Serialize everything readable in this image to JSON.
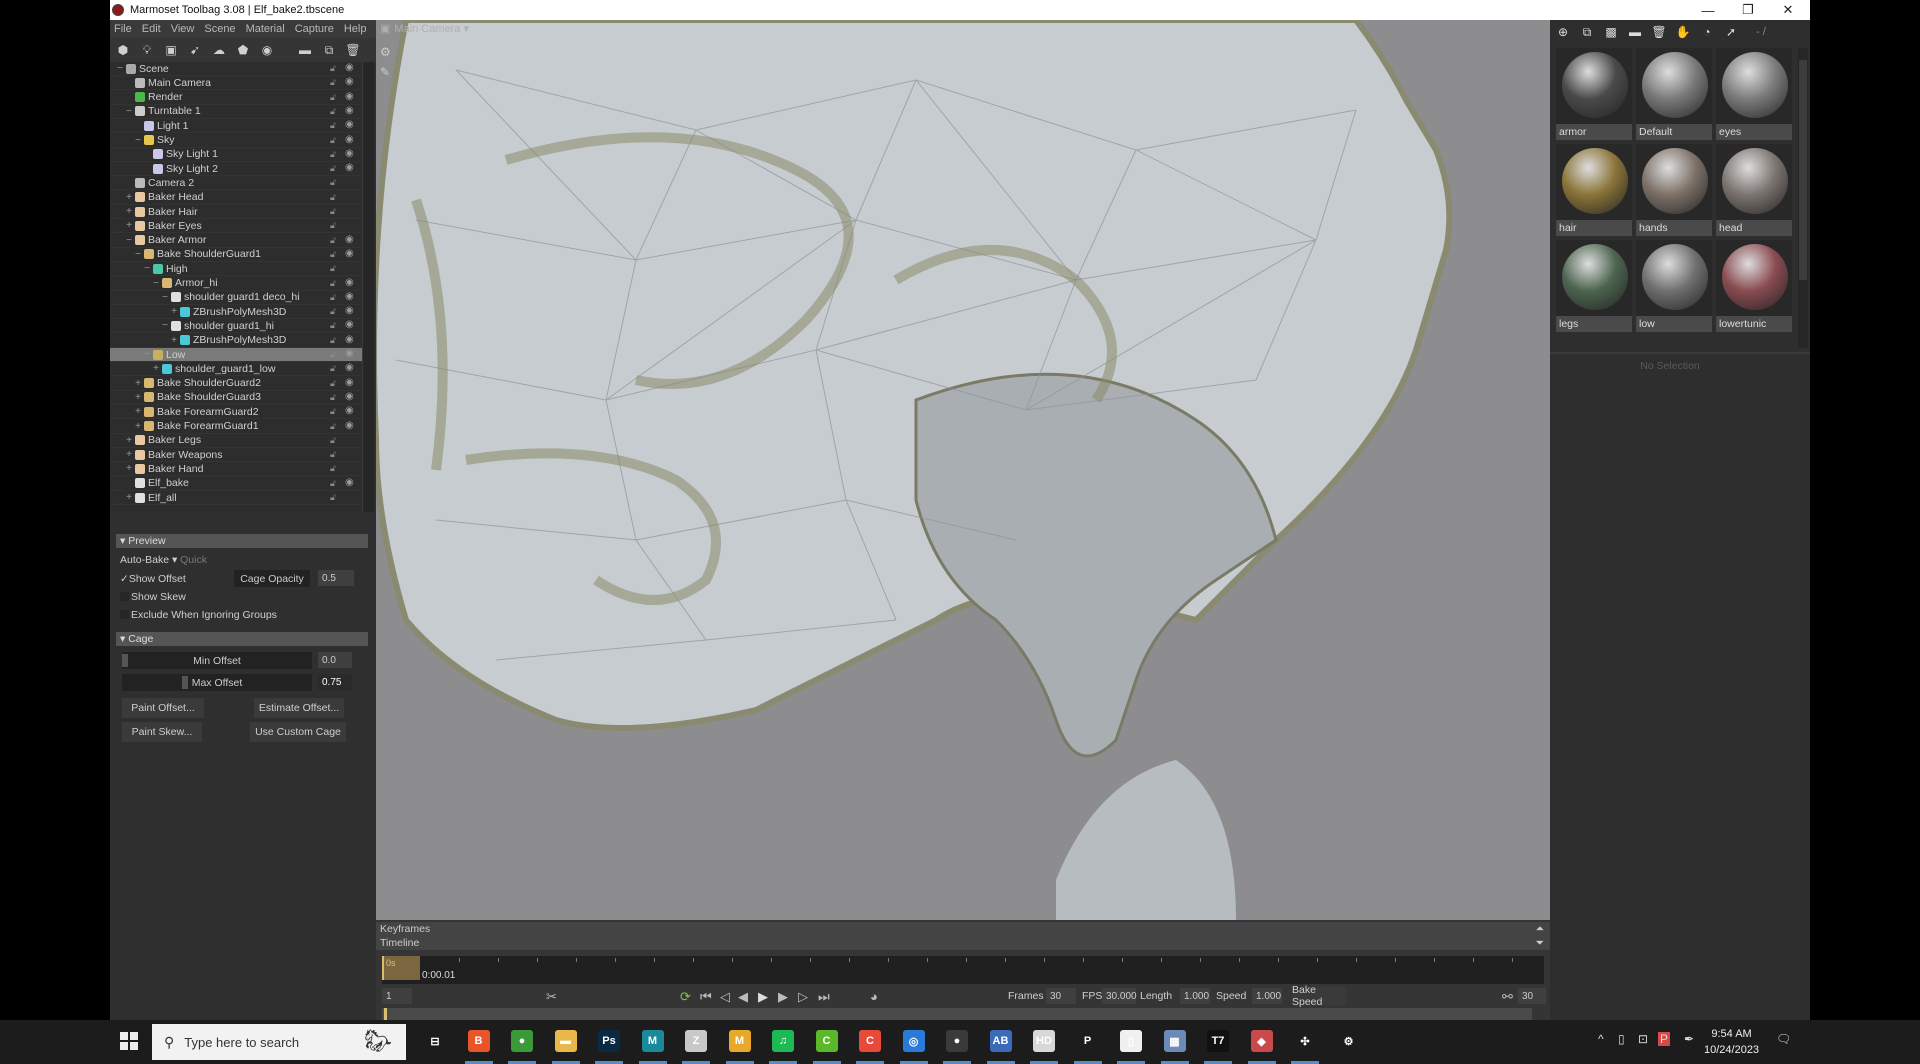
{
  "window": {
    "title": "Marmoset Toolbag 3.08 | Elf_bake2.tbscene",
    "controls": [
      "minimize",
      "restore",
      "close"
    ]
  },
  "menu": [
    "File",
    "Edit",
    "View",
    "Scene",
    "Material",
    "Capture",
    "Help"
  ],
  "toolbar_icons": [
    "new-mesh-icon",
    "new-light-icon",
    "new-camera-icon",
    "new-turntable-icon",
    "new-sky-icon",
    "new-baker-icon",
    "new-render-icon",
    "open-folder-icon",
    "duplicate-icon",
    "delete-icon"
  ],
  "scene_tree": [
    {
      "label": "Scene",
      "depth": 0,
      "icon": "scene",
      "exp": "−",
      "eye": true
    },
    {
      "label": "Main Camera",
      "depth": 1,
      "icon": "camera",
      "exp": "",
      "eye": true
    },
    {
      "label": "Render",
      "depth": 1,
      "icon": "render",
      "exp": "",
      "eye": true
    },
    {
      "label": "Turntable 1",
      "depth": 1,
      "icon": "turntable",
      "exp": "−",
      "eye": true
    },
    {
      "label": "Light 1",
      "depth": 2,
      "icon": "light",
      "exp": "",
      "eye": true
    },
    {
      "label": "Sky",
      "depth": 2,
      "icon": "sky",
      "exp": "−",
      "eye": true
    },
    {
      "label": "Sky Light 1",
      "depth": 3,
      "icon": "light",
      "exp": "",
      "eye": true
    },
    {
      "label": "Sky Light 2",
      "depth": 3,
      "icon": "light",
      "exp": "",
      "eye": true
    },
    {
      "label": "Camera 2",
      "depth": 1,
      "icon": "camera",
      "exp": "",
      "eye": false
    },
    {
      "label": "Baker Head",
      "depth": 1,
      "icon": "baker",
      "exp": "+",
      "eye": false
    },
    {
      "label": "Baker Hair",
      "depth": 1,
      "icon": "baker",
      "exp": "+",
      "eye": false
    },
    {
      "label": "Baker Eyes",
      "depth": 1,
      "icon": "baker",
      "exp": "+",
      "eye": false
    },
    {
      "label": "Baker Armor",
      "depth": 1,
      "icon": "baker",
      "exp": "−",
      "eye": true
    },
    {
      "label": "Bake ShoulderGuard1",
      "depth": 2,
      "icon": "folder",
      "exp": "−",
      "eye": true
    },
    {
      "label": "High",
      "depth": 3,
      "icon": "high",
      "exp": "−",
      "eye": false
    },
    {
      "label": "Armor_hi",
      "depth": 4,
      "icon": "folder",
      "exp": "−",
      "eye": true
    },
    {
      "label": "shoulder guard1 deco_hi",
      "depth": 5,
      "icon": "file",
      "exp": "−",
      "eye": true
    },
    {
      "label": "ZBrushPolyMesh3D",
      "depth": 6,
      "icon": "mesh",
      "exp": "+",
      "eye": true
    },
    {
      "label": "shoulder guard1_hi",
      "depth": 5,
      "icon": "file",
      "exp": "−",
      "eye": true
    },
    {
      "label": "ZBrushPolyMesh3D",
      "depth": 6,
      "icon": "mesh",
      "exp": "+",
      "eye": true
    },
    {
      "label": "Low",
      "depth": 3,
      "icon": "low",
      "exp": "−",
      "eye": true,
      "selected": true
    },
    {
      "label": "shoulder_guard1_low",
      "depth": 4,
      "icon": "mesh",
      "exp": "+",
      "eye": true
    },
    {
      "label": "Bake ShoulderGuard2",
      "depth": 2,
      "icon": "folder",
      "exp": "+",
      "eye": true
    },
    {
      "label": "Bake ShoulderGuard3",
      "depth": 2,
      "icon": "folder",
      "exp": "+",
      "eye": true
    },
    {
      "label": "Bake ForearmGuard2",
      "depth": 2,
      "icon": "folder",
      "exp": "+",
      "eye": true
    },
    {
      "label": "Bake ForearmGuard1",
      "depth": 2,
      "icon": "folder",
      "exp": "+",
      "eye": true
    },
    {
      "label": "Baker Legs",
      "depth": 1,
      "icon": "baker",
      "exp": "+",
      "eye": false
    },
    {
      "label": "Baker Weapons",
      "depth": 1,
      "icon": "baker",
      "exp": "+",
      "eye": false
    },
    {
      "label": "Baker Hand",
      "depth": 1,
      "icon": "baker",
      "exp": "+",
      "eye": false
    },
    {
      "label": "Elf_bake",
      "depth": 1,
      "icon": "file",
      "exp": "",
      "eye": true
    },
    {
      "label": "Elf_all",
      "depth": 1,
      "icon": "file",
      "exp": "+",
      "eye": false
    }
  ],
  "preview": {
    "header": "Preview",
    "auto_bake": "Auto-Bake",
    "quick": "Quick",
    "show_offset": "Show Offset",
    "show_offset_checked": true,
    "cage_opacity_label": "Cage Opacity",
    "cage_opacity_value": "0.5",
    "show_skew": "Show Skew",
    "show_skew_checked": false,
    "exclude_groups": "Exclude When Ignoring Groups",
    "exclude_groups_checked": false
  },
  "cage": {
    "header": "Cage",
    "min_offset_label": "Min Offset",
    "min_offset_value": "0.0",
    "max_offset_label": "Max Offset",
    "max_offset_value": "0.75",
    "paint_offset": "Paint Offset...",
    "estimate_offset": "Estimate Offset...",
    "paint_skew": "Paint Skew...",
    "use_custom_cage": "Use Custom Cage"
  },
  "viewport": {
    "camera_label": "Main Camera"
  },
  "materials": {
    "toolbar_icons": [
      "add-material-icon",
      "duplicate-material-icon",
      "checker-icon",
      "folder-icon",
      "delete-icon",
      "pick-icon",
      "apply-icon",
      "export-icon"
    ],
    "page_indicator": "- /",
    "items": [
      {
        "name": "armor",
        "color": "#4a4a4a"
      },
      {
        "name": "Default",
        "color": "#7a7a7a"
      },
      {
        "name": "eyes",
        "color": "#7c7c7c"
      },
      {
        "name": "hair",
        "color": "#8a7438"
      },
      {
        "name": "hands",
        "color": "#7d7168"
      },
      {
        "name": "head",
        "color": "#7c7470"
      },
      {
        "name": "legs",
        "color": "#4d6550"
      },
      {
        "name": "low",
        "color": "#707070"
      },
      {
        "name": "lowertunic",
        "color": "#8a4c52"
      }
    ],
    "no_selection": "No Selection"
  },
  "timeline": {
    "keyframes_label": "Keyframes",
    "timeline_label": "Timeline",
    "marker_label": "0s",
    "current_time": "0:00.01",
    "frame_field": "1",
    "frames_label": "Frames",
    "frames_value": "30",
    "fps_label": "FPS",
    "fps_value": "30.000",
    "length_label": "Length",
    "length_value": "1.000",
    "speed_label": "Speed",
    "speed_value": "1.000",
    "bake_speed": "Bake Speed",
    "link_value": "30"
  },
  "taskbar": {
    "search_placeholder": "Type here to search",
    "apps": [
      {
        "name": "task-view",
        "glyph": "⊟",
        "color": "#1c1c1c"
      },
      {
        "name": "brave",
        "glyph": "B",
        "color": "#e8552b"
      },
      {
        "name": "chrome",
        "glyph": "●",
        "color": "#3a9a3a"
      },
      {
        "name": "file-explorer",
        "glyph": "▬",
        "color": "#e8b84a"
      },
      {
        "name": "photoshop",
        "glyph": "Ps",
        "color": "#0a2a44"
      },
      {
        "name": "maya",
        "glyph": "M",
        "color": "#1a8a9a"
      },
      {
        "name": "zbrush",
        "glyph": "Z",
        "color": "#c8c8c8"
      },
      {
        "name": "marmoset-m",
        "glyph": "M",
        "color": "#e8a82a"
      },
      {
        "name": "spotify",
        "glyph": "♫",
        "color": "#1db954"
      },
      {
        "name": "camtasia-green",
        "glyph": "C",
        "color": "#5ab82a"
      },
      {
        "name": "camtasia-red",
        "glyph": "C",
        "color": "#e84a3a"
      },
      {
        "name": "browser-blue",
        "glyph": "◎",
        "color": "#2a7ad8"
      },
      {
        "name": "marmoset-toolbag",
        "glyph": "●",
        "color": "#3a3a3a"
      },
      {
        "name": "translator",
        "glyph": "AB",
        "color": "#3a6ab8"
      },
      {
        "name": "hd-app",
        "glyph": "HD",
        "color": "#d8d8d8"
      },
      {
        "name": "p-app",
        "glyph": "P",
        "color": "#1c1c1c"
      },
      {
        "name": "notepad",
        "glyph": "▯",
        "color": "#f0f0f0"
      },
      {
        "name": "calculator",
        "glyph": "▦",
        "color": "#6a8ab8"
      },
      {
        "name": "t7-app",
        "glyph": "T7",
        "color": "#111111"
      },
      {
        "name": "substance",
        "glyph": "◆",
        "color": "#c84a4a"
      },
      {
        "name": "fan-app",
        "glyph": "✣",
        "color": "#1c1c1c"
      },
      {
        "name": "settings-app",
        "glyph": "⚙",
        "color": "#1c1c1c"
      }
    ],
    "tray": {
      "time": "9:54 AM",
      "date": "10/24/2023"
    }
  }
}
